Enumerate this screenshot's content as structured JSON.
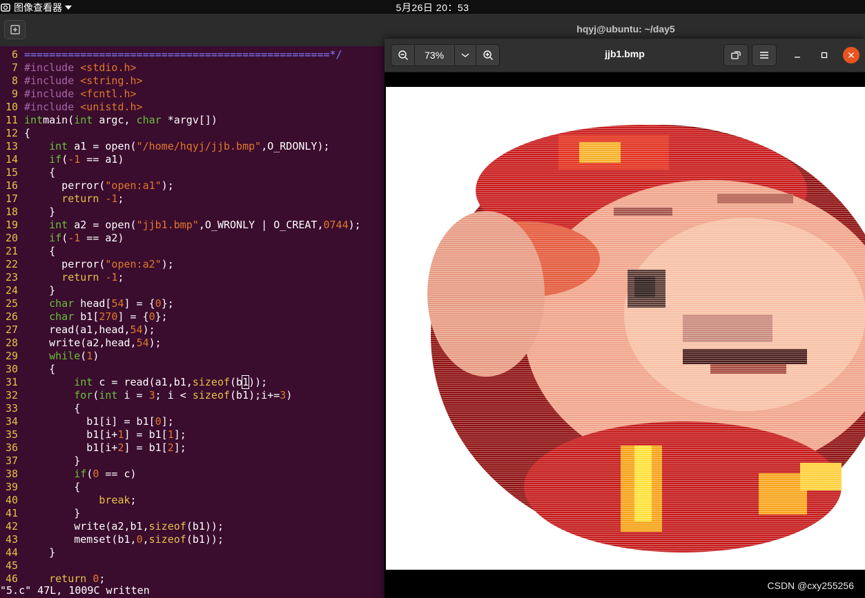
{
  "topbar": {
    "app_name": "图像查看器",
    "clock": "5月26日 20：53"
  },
  "terminal": {
    "title": "hqyj@ubuntu: ~/day5",
    "lines": [
      {
        "n": "6",
        "t": [
          [
            "cm",
            "=================================================*/"
          ]
        ]
      },
      {
        "n": "7",
        "t": [
          [
            "pp",
            "#include "
          ],
          [
            "inc",
            "<stdio.h>"
          ]
        ]
      },
      {
        "n": "8",
        "t": [
          [
            "pp",
            "#include "
          ],
          [
            "inc",
            "<string.h>"
          ]
        ]
      },
      {
        "n": "9",
        "t": [
          [
            "pp",
            "#include "
          ],
          [
            "inc",
            "<fcntl.h>"
          ]
        ]
      },
      {
        "n": "10",
        "t": [
          [
            "pp",
            "#include "
          ],
          [
            "inc",
            "<unistd.h>"
          ]
        ]
      },
      {
        "n": "11",
        "t": [
          [
            "ty",
            "int"
          ],
          [
            "",
            "main("
          ],
          [
            "ty",
            "int"
          ],
          [
            "",
            " argc, "
          ],
          [
            "ty",
            "char"
          ],
          [
            "",
            " *argv[])"
          ]
        ]
      },
      {
        "n": "12",
        "t": [
          [
            "",
            "{"
          ]
        ]
      },
      {
        "n": "13",
        "t": [
          [
            "",
            "    "
          ],
          [
            "ty",
            "int"
          ],
          [
            "",
            " a1 = open("
          ],
          [
            "st",
            "\"/home/hqyj/jjb.bmp\""
          ],
          [
            "",
            ",O_RDONLY);"
          ]
        ]
      },
      {
        "n": "14",
        "t": [
          [
            "",
            "    "
          ],
          [
            "kw",
            "if"
          ],
          [
            "",
            "("
          ],
          [
            "nu",
            "-1"
          ],
          [
            "",
            " == a1)"
          ]
        ]
      },
      {
        "n": "15",
        "t": [
          [
            "",
            "    {"
          ]
        ]
      },
      {
        "n": "16",
        "t": [
          [
            "",
            "      perror("
          ],
          [
            "st",
            "\"open:a1\""
          ],
          [
            "",
            ");"
          ]
        ]
      },
      {
        "n": "17",
        "t": [
          [
            "",
            "      "
          ],
          [
            "br",
            "return"
          ],
          [
            "",
            " "
          ],
          [
            "nu",
            "-1"
          ],
          [
            "",
            ";"
          ]
        ]
      },
      {
        "n": "18",
        "t": [
          [
            "",
            "    }"
          ]
        ]
      },
      {
        "n": "19",
        "t": [
          [
            "",
            "    "
          ],
          [
            "ty",
            "int"
          ],
          [
            "",
            " a2 = open("
          ],
          [
            "st",
            "\"jjb1.bmp\""
          ],
          [
            "",
            ",O_WRONLY | O_CREAT,"
          ],
          [
            "nu",
            "0744"
          ],
          [
            "",
            ");"
          ]
        ]
      },
      {
        "n": "20",
        "t": [
          [
            "",
            "    "
          ],
          [
            "kw",
            "if"
          ],
          [
            "",
            "("
          ],
          [
            "nu",
            "-1"
          ],
          [
            "",
            " == a2)"
          ]
        ]
      },
      {
        "n": "21",
        "t": [
          [
            "",
            "    {"
          ]
        ]
      },
      {
        "n": "22",
        "t": [
          [
            "",
            "      perror("
          ],
          [
            "st",
            "\"open:a2\""
          ],
          [
            "",
            ");"
          ]
        ]
      },
      {
        "n": "23",
        "t": [
          [
            "",
            "      "
          ],
          [
            "br",
            "return"
          ],
          [
            "",
            " "
          ],
          [
            "nu",
            "-1"
          ],
          [
            "",
            ";"
          ]
        ]
      },
      {
        "n": "24",
        "t": [
          [
            "",
            "    }"
          ]
        ]
      },
      {
        "n": "25",
        "t": [
          [
            "",
            "    "
          ],
          [
            "ty",
            "char"
          ],
          [
            "",
            " head["
          ],
          [
            "nu",
            "54"
          ],
          [
            "",
            "] = {"
          ],
          [
            "nu",
            "0"
          ],
          [
            "",
            "};"
          ]
        ]
      },
      {
        "n": "26",
        "t": [
          [
            "",
            "    "
          ],
          [
            "ty",
            "char"
          ],
          [
            "",
            " b1["
          ],
          [
            "nu",
            "270"
          ],
          [
            "",
            "] = {"
          ],
          [
            "nu",
            "0"
          ],
          [
            "",
            "};"
          ]
        ]
      },
      {
        "n": "27",
        "t": [
          [
            "",
            "    read(a1,head,"
          ],
          [
            "nu",
            "54"
          ],
          [
            "",
            ");"
          ]
        ]
      },
      {
        "n": "28",
        "t": [
          [
            "",
            "    write(a2,head,"
          ],
          [
            "nu",
            "54"
          ],
          [
            "",
            ");"
          ]
        ]
      },
      {
        "n": "29",
        "t": [
          [
            "",
            "    "
          ],
          [
            "kw",
            "while"
          ],
          [
            "",
            "("
          ],
          [
            "nu",
            "1"
          ],
          [
            "",
            ")"
          ]
        ]
      },
      {
        "n": "30",
        "t": [
          [
            "",
            "    {"
          ]
        ]
      },
      {
        "n": "31",
        "t": [
          [
            "",
            "        "
          ],
          [
            "ty",
            "int"
          ],
          [
            "",
            " c = read(a1,b1,"
          ],
          [
            "br",
            "sizeof"
          ],
          [
            "",
            "(b"
          ],
          [
            "cursor",
            "1"
          ],
          [
            "",
            "));"
          ]
        ]
      },
      {
        "n": "32",
        "t": [
          [
            "",
            "        "
          ],
          [
            "kw",
            "for"
          ],
          [
            "",
            "("
          ],
          [
            "ty",
            "int"
          ],
          [
            "",
            " i = "
          ],
          [
            "nu",
            "3"
          ],
          [
            "",
            "; i < "
          ],
          [
            "br",
            "sizeof"
          ],
          [
            "",
            "(b1);i+="
          ],
          [
            "nu",
            "3"
          ],
          [
            "",
            ")"
          ]
        ]
      },
      {
        "n": "33",
        "t": [
          [
            "",
            "        {"
          ]
        ]
      },
      {
        "n": "34",
        "t": [
          [
            "",
            "          b1[i] = b1["
          ],
          [
            "nu",
            "0"
          ],
          [
            "",
            "];"
          ]
        ]
      },
      {
        "n": "35",
        "t": [
          [
            "",
            "          b1[i+"
          ],
          [
            "nu",
            "1"
          ],
          [
            "",
            "] = b1["
          ],
          [
            "nu",
            "1"
          ],
          [
            "",
            "];"
          ]
        ]
      },
      {
        "n": "36",
        "t": [
          [
            "",
            "          b1[i+"
          ],
          [
            "nu",
            "2"
          ],
          [
            "",
            "] = b1["
          ],
          [
            "nu",
            "2"
          ],
          [
            "",
            "];"
          ]
        ]
      },
      {
        "n": "37",
        "t": [
          [
            "",
            "        }"
          ]
        ]
      },
      {
        "n": "38",
        "t": [
          [
            "",
            "        "
          ],
          [
            "kw",
            "if"
          ],
          [
            "",
            "("
          ],
          [
            "nu",
            "0"
          ],
          [
            "",
            " == c)"
          ]
        ]
      },
      {
        "n": "39",
        "t": [
          [
            "",
            "        {"
          ]
        ]
      },
      {
        "n": "40",
        "t": [
          [
            "",
            "            "
          ],
          [
            "br",
            "break"
          ],
          [
            "",
            ";"
          ]
        ]
      },
      {
        "n": "41",
        "t": [
          [
            "",
            "        }"
          ]
        ]
      },
      {
        "n": "42",
        "t": [
          [
            "",
            "        write(a2,b1,"
          ],
          [
            "br",
            "sizeof"
          ],
          [
            "",
            "(b1));"
          ]
        ]
      },
      {
        "n": "43",
        "t": [
          [
            "",
            "        memset(b1,"
          ],
          [
            "nu",
            "0"
          ],
          [
            "",
            ","
          ],
          [
            "br",
            "sizeof"
          ],
          [
            "",
            "(b1));"
          ]
        ]
      },
      {
        "n": "44",
        "t": [
          [
            "",
            "    }"
          ]
        ]
      },
      {
        "n": "45",
        "t": []
      },
      {
        "n": "46",
        "t": [
          [
            "",
            "    "
          ],
          [
            "br",
            "return"
          ],
          [
            "",
            " "
          ],
          [
            "nu",
            "0"
          ],
          [
            "",
            ";"
          ]
        ]
      }
    ],
    "status": "\"5.c\" 47L, 1009C written"
  },
  "viewer": {
    "title": "jjb1.bmp",
    "zoom": "73%",
    "icons": {
      "zoom_out": "zoom-out-icon",
      "zoom_menu": "chevron-down-icon",
      "zoom_in": "zoom-in-icon",
      "rotate": "rotate-icon",
      "menu": "hamburger-menu-icon",
      "minimize": "minimize-icon",
      "maximize": "maximize-icon",
      "close": "close-icon"
    },
    "accent_close": "#e95420"
  },
  "watermark": "CSDN @cxy255256"
}
